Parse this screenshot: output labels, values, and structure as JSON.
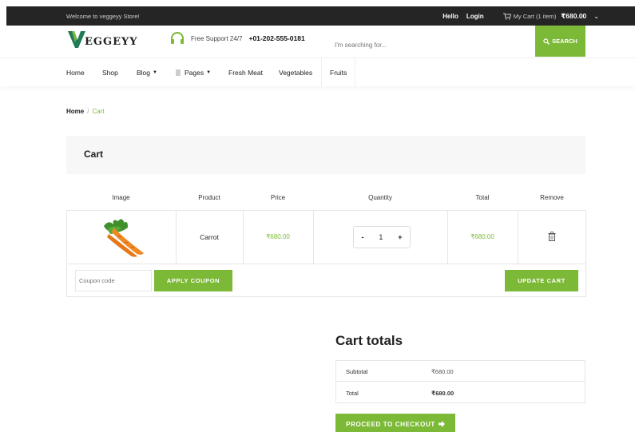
{
  "topbar": {
    "welcome": "Welcome to veggeyy Store!",
    "hello": "Hello",
    "login": "Login",
    "cart_label": "My Cart (1 item)",
    "cart_amount": "₹680.00"
  },
  "header": {
    "logo_text": "EGGEYY",
    "support_text": "Free Support 24/7",
    "phone": "+01-202-555-0181",
    "search_placeholder": "I'm searching for...",
    "search_button": "SEARCH"
  },
  "nav": {
    "items": [
      "Home",
      "Shop",
      "Blog",
      "Pages",
      "Fresh Meat",
      "Vegetables",
      "Fruits"
    ]
  },
  "breadcrumb": {
    "home": "Home",
    "separator": "/",
    "current": "Cart"
  },
  "cart": {
    "title": "Cart",
    "columns": [
      "Image",
      "Product",
      "Price",
      "Quantity",
      "Total",
      "Remove"
    ],
    "items": [
      {
        "product": "Carrot",
        "price": "₹680.00",
        "quantity": "1",
        "total": "₹680.00"
      }
    ],
    "coupon_placeholder": "Coupon code",
    "apply_coupon": "APPLY COUPON",
    "update_cart": "UPDATE CART"
  },
  "totals": {
    "title": "Cart totals",
    "subtotal_label": "Subtotal",
    "subtotal_value": "₹680.00",
    "total_label": "Total",
    "total_value": "₹680.00",
    "checkout": "PROCEED TO CHECKOUT"
  },
  "colors": {
    "accent": "#7cb936",
    "topbar": "#252525"
  }
}
